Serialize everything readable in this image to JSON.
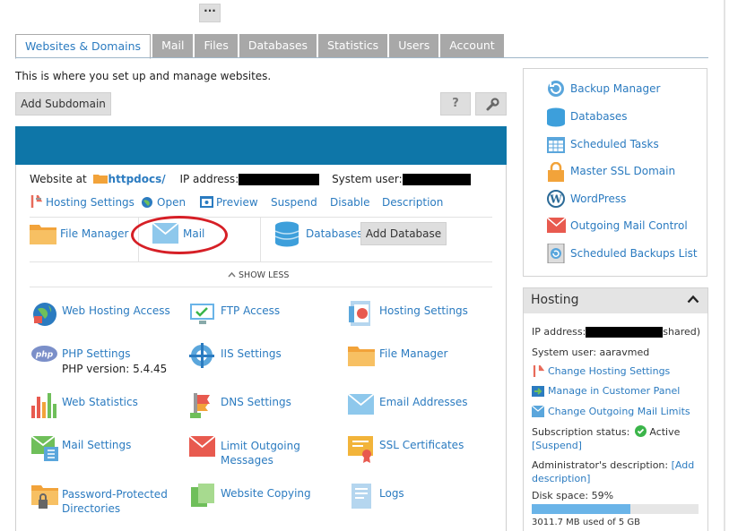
{
  "toolbar": {
    "more_label": "···"
  },
  "tabs": [
    {
      "label": "Websites & Domains",
      "active": true
    },
    {
      "label": "Mail"
    },
    {
      "label": "Files"
    },
    {
      "label": "Databases"
    },
    {
      "label": "Statistics"
    },
    {
      "label": "Users"
    },
    {
      "label": "Account"
    }
  ],
  "intro_text": "This is where you set up and manage websites.",
  "add_subdomain_label": "Add Subdomain",
  "help_label": "?",
  "website": {
    "website_at_label": "Website at",
    "docroot": "httpdocs/",
    "ip_label": "IP address:",
    "system_user_label": "System user:",
    "actions": [
      "Hosting Settings",
      "Open",
      "Preview",
      "Suspend",
      "Disable",
      "Description"
    ],
    "quick": {
      "file_manager": "File Manager",
      "mail": "Mail",
      "databases": "Databases",
      "add_database": "Add Database"
    },
    "show_less": "SHOW LESS",
    "tools": [
      {
        "label": "Web Hosting Access",
        "icon": "web-hosting-access-icon"
      },
      {
        "label": "FTP Access",
        "icon": "ftp-access-icon"
      },
      {
        "label": "Hosting Settings",
        "icon": "hosting-settings-icon"
      },
      {
        "label": "PHP Settings",
        "sub": "PHP version: 5.4.45",
        "icon": "php-icon"
      },
      {
        "label": "IIS Settings",
        "icon": "iis-settings-icon"
      },
      {
        "label": "File Manager",
        "icon": "folder-icon"
      },
      {
        "label": "Web Statistics",
        "icon": "statistics-icon"
      },
      {
        "label": "DNS Settings",
        "icon": "dns-icon"
      },
      {
        "label": "Email Addresses",
        "icon": "email-icon"
      },
      {
        "label": "Mail Settings",
        "icon": "mail-settings-icon"
      },
      {
        "label": "Limit Outgoing Messages",
        "icon": "limit-mail-icon"
      },
      {
        "label": "SSL Certificates",
        "icon": "certificate-icon"
      },
      {
        "label": "Password-Protected Directories",
        "icon": "protected-folder-icon"
      },
      {
        "label": "Website Copying",
        "icon": "copy-icon"
      },
      {
        "label": "Logs",
        "icon": "logs-icon"
      }
    ]
  },
  "sidebar": {
    "items": [
      {
        "label": "Backup Manager",
        "icon": "backup-icon"
      },
      {
        "label": "Databases",
        "icon": "database-icon"
      },
      {
        "label": "Scheduled Tasks",
        "icon": "calendar-icon"
      },
      {
        "label": "Master SSL Domain",
        "icon": "lock-icon"
      },
      {
        "label": "WordPress",
        "icon": "wordpress-icon"
      },
      {
        "label": "Outgoing Mail Control",
        "icon": "mail-control-icon"
      },
      {
        "label": "Scheduled Backups List",
        "icon": "backup-list-icon"
      }
    ]
  },
  "hosting": {
    "title": "Hosting",
    "ip_label": "IP address:",
    "ip_suffix": "shared)",
    "system_user": "System user: aaravmed",
    "change_hosting": "Change Hosting Settings",
    "manage_panel": "Manage in Customer Panel",
    "change_mail_limits": "Change Outgoing Mail Limits",
    "subscription_label": "Subscription status:",
    "subscription_value": "Active",
    "suspend": "[Suspend]",
    "admin_desc_label": "Administrator's description:",
    "admin_desc_add": "[Add",
    "admin_desc_add2": "description]",
    "disk_space": "Disk space: 59%",
    "disk_fraction": 0.59,
    "disk_used": "3011.7 MB used of 5 GB"
  },
  "colors": {
    "brand_blue": "#0e76a8",
    "link": "#2b7bc0",
    "highlight": "#d61f26",
    "active_green": "#3bb54a"
  }
}
